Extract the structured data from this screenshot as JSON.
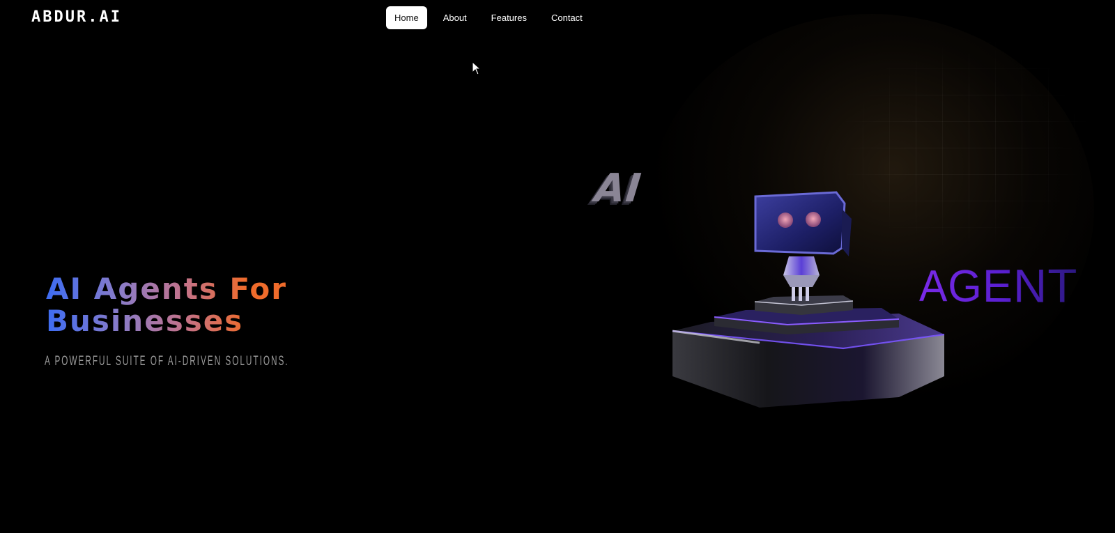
{
  "header": {
    "logo": "ABDUR.AI",
    "nav": [
      {
        "label": "Home",
        "active": true
      },
      {
        "label": "About",
        "active": false
      },
      {
        "label": "Features",
        "active": false
      },
      {
        "label": "Contact",
        "active": false
      }
    ]
  },
  "hero": {
    "title_line1": "AI Agents For",
    "title_line2": "Businesses",
    "subtitle": "A POWERFUL SUITE OF AI-DRIVEN SOLUTIONS."
  },
  "scene": {
    "float_text_left": "AI",
    "float_text_right": "AGENT",
    "icons": [
      "robot-icon"
    ]
  },
  "colors": {
    "background": "#000000",
    "accent_blue": "#3d6cf2",
    "accent_orange": "#ef6b2b",
    "accent_purple": "#7a2ae8"
  }
}
